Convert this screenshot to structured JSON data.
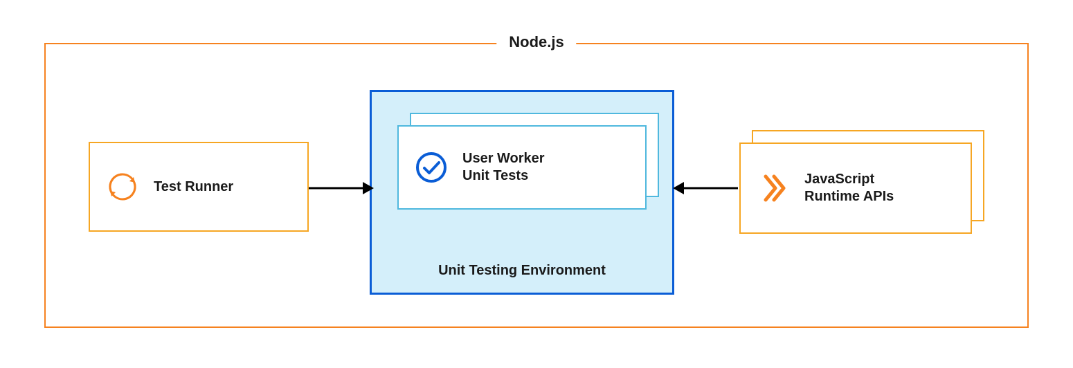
{
  "outer": {
    "label": "Node.js"
  },
  "env": {
    "label": "Unit Testing Environment"
  },
  "cards": {
    "test_runner": {
      "label": "Test Runner"
    },
    "worker_tests": {
      "line1": "User Worker",
      "line2": "Unit Tests"
    },
    "runtime_apis": {
      "line1": "JavaScript",
      "line2": "Runtime APIs"
    }
  },
  "colors": {
    "orange": "#f6821f",
    "yellow_orange": "#f6a623",
    "blue": "#0a5dd6",
    "lightblue_border": "#4fb8de",
    "lightblue_bg": "#d4effa",
    "text": "#1a1a1a",
    "arrow": "#000"
  }
}
